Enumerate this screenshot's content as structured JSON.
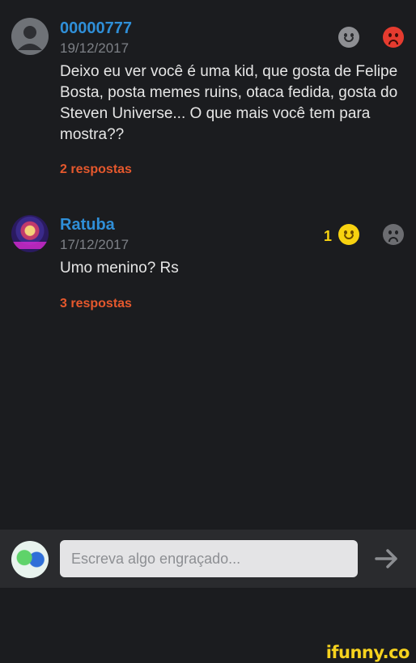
{
  "comments": [
    {
      "username": "00000777",
      "date": "19/12/2017",
      "text": "Deixo eu ver você é uma kid, que gosta de Felipe Bosta, posta memes ruins, otaca fedida, gosta do Steven Universe... O que mais você tem para mostra??",
      "replies": "2 respostas",
      "likes": ""
    },
    {
      "username": "Ratuba",
      "date": "17/12/2017",
      "text": "Umo menino? Rs",
      "replies": "3 respostas",
      "likes": "1"
    }
  ],
  "composer": {
    "placeholder": "Escreva algo engraçado..."
  },
  "icons": {
    "send": "arrow-right-icon",
    "like": "smiley-happy-icon",
    "dislike": "smiley-sad-icon"
  },
  "colors": {
    "background": "#1b1c1f",
    "username": "#2f8fd8",
    "replies": "#e5582d",
    "like_active": "#f8d210",
    "dislike_active": "#e53b2f"
  },
  "watermark": "ifunny.co"
}
